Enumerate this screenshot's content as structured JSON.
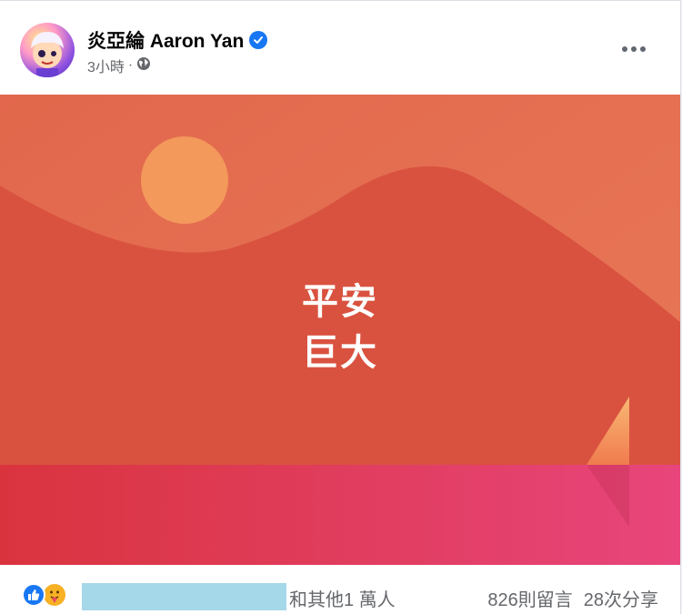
{
  "post": {
    "author_name": "炎亞綸 Aaron Yan",
    "timestamp": "3小時",
    "separator": "·",
    "privacy_icon": "globe-icon",
    "verified_icon": "verified-badge-icon",
    "more_icon": "more-options-icon"
  },
  "image": {
    "line1": "平安",
    "line2": "巨大",
    "colors": {
      "sky": "#e06a4e",
      "sun": "#f5a05e",
      "mountain": "#d9513f",
      "water": "#e0456a"
    }
  },
  "footer": {
    "reaction_icons": [
      "like-icon",
      "care-icon"
    ],
    "others_text": "和其他1 萬人",
    "comments": "826則留言",
    "shares": "28次分享"
  },
  "colors": {
    "accent": "#1877f2",
    "secondary_text": "#65676b",
    "redaction": "#a5d8e8"
  }
}
